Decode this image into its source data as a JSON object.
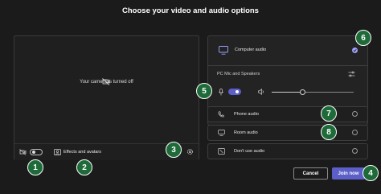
{
  "header": {
    "title": "Choose your video and audio options"
  },
  "video": {
    "camera_message": "Your camera is turned off",
    "camera_toggle_on": false,
    "effects_label": "Effects and avatars"
  },
  "audio": {
    "computer_audio_label": "Computer audio",
    "device_label": "PC Mic and Speakers",
    "mic_toggle_on": true,
    "volume_level_pct": 38,
    "options": [
      {
        "label": "Phone audio"
      },
      {
        "label": "Room audio"
      },
      {
        "label": "Don't use audio"
      }
    ]
  },
  "actions": {
    "cancel_label": "Cancel",
    "join_label": "Join now"
  },
  "callouts": [
    "1",
    "2",
    "3",
    "4",
    "5",
    "6",
    "7",
    "8"
  ],
  "colors": {
    "accent": "#5b5fc7",
    "callout_bg": "#1e6b39",
    "check": "#9ea2ff"
  }
}
